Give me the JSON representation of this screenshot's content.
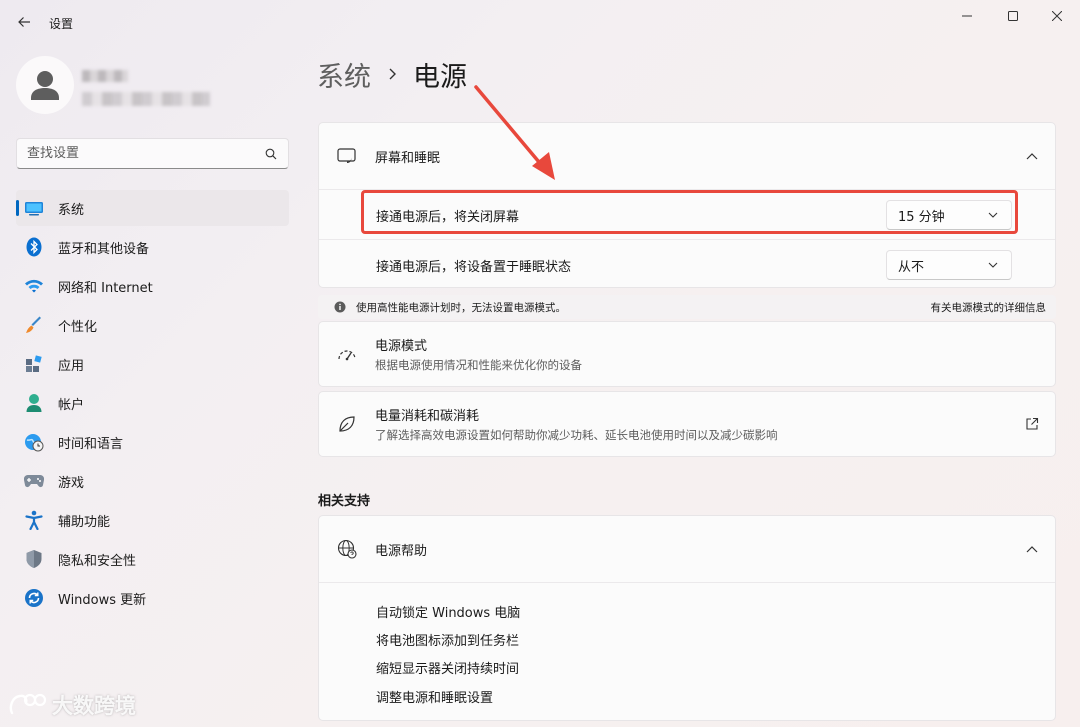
{
  "window": {
    "title": "设置"
  },
  "search": {
    "placeholder": "查找设置"
  },
  "sidebar": {
    "items": [
      {
        "label": "系统",
        "icon": "monitor-icon",
        "active": true
      },
      {
        "label": "蓝牙和其他设备",
        "icon": "bluetooth-icon"
      },
      {
        "label": "网络和 Internet",
        "icon": "wifi-icon"
      },
      {
        "label": "个性化",
        "icon": "brush-icon"
      },
      {
        "label": "应用",
        "icon": "apps-icon"
      },
      {
        "label": "帐户",
        "icon": "account-icon"
      },
      {
        "label": "时间和语言",
        "icon": "globe-clock-icon"
      },
      {
        "label": "游戏",
        "icon": "gamepad-icon"
      },
      {
        "label": "辅助功能",
        "icon": "accessibility-icon"
      },
      {
        "label": "隐私和安全性",
        "icon": "shield-icon"
      },
      {
        "label": "Windows 更新",
        "icon": "update-icon"
      }
    ]
  },
  "breadcrumb": {
    "parent": "系统",
    "current": "电源"
  },
  "screen_sleep": {
    "title": "屏幕和睡眠",
    "rows": [
      {
        "label": "接通电源后，将关闭屏幕",
        "value": "15 分钟"
      },
      {
        "label": "接通电源后，将设备置于睡眠状态",
        "value": "从不"
      }
    ]
  },
  "info_bar": {
    "text": "使用高性能电源计划时，无法设置电源模式。",
    "link": "有关电源模式的详细信息"
  },
  "power_mode": {
    "title": "电源模式",
    "description": "根据电源使用情况和性能来优化你的设备"
  },
  "energy": {
    "title": "电量消耗和碳消耗",
    "description": "了解选择高效电源设置如何帮助你减少功耗、延长电池使用时间以及减少碳影响"
  },
  "related": {
    "section_title": "相关支持",
    "help_title": "电源帮助",
    "links": [
      "自动锁定 Windows 电脑",
      "将电池图标添加到任务栏",
      "缩短显示器关闭持续时间",
      "调整电源和睡眠设置"
    ]
  },
  "watermark": {
    "text": "大数跨境"
  },
  "colors": {
    "accent": "#0067c0",
    "highlight": "#e8483c"
  }
}
